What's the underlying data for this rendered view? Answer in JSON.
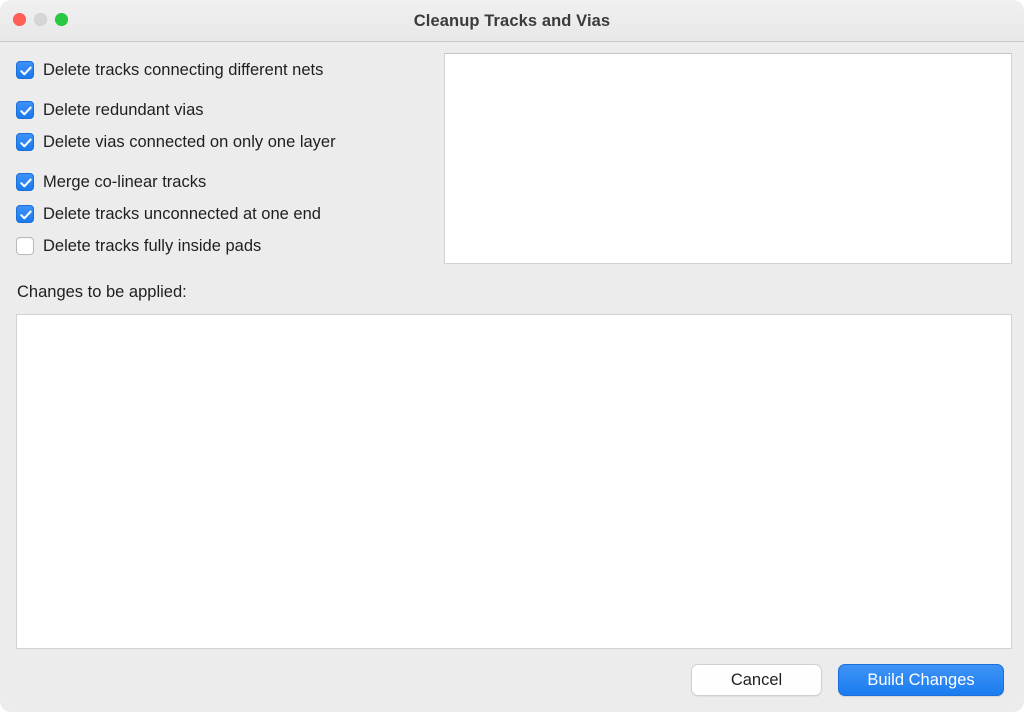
{
  "window": {
    "title": "Cleanup Tracks and Vias",
    "controls": [
      {
        "name": "close",
        "color": "#FF5F57"
      },
      {
        "name": "minimize",
        "color": "#D6D6D6"
      },
      {
        "name": "zoom",
        "color": "#28C840"
      }
    ]
  },
  "options": [
    {
      "label": "Delete tracks connecting different nets",
      "checked": true,
      "gap_after": true
    },
    {
      "label": "Delete redundant vias",
      "checked": true,
      "gap_after": false
    },
    {
      "label": "Delete vias connected on only one layer",
      "checked": true,
      "gap_after": true
    },
    {
      "label": "Merge co-linear tracks",
      "checked": true,
      "gap_after": false
    },
    {
      "label": "Delete tracks unconnected at one end",
      "checked": true,
      "gap_after": false
    },
    {
      "label": "Delete tracks fully inside pads",
      "checked": false,
      "gap_after": false
    }
  ],
  "preview_panel": {
    "content": ""
  },
  "changes": {
    "label": "Changes to be applied:",
    "content": ""
  },
  "footer": {
    "cancel_label": "Cancel",
    "build_label": "Build Changes"
  },
  "colors": {
    "accent": "#1A7CF0",
    "window_bg": "#ECECEC",
    "panel_bg": "#FFFFFF",
    "text": "#1F1F1F",
    "title_text": "#3B3B3B"
  }
}
